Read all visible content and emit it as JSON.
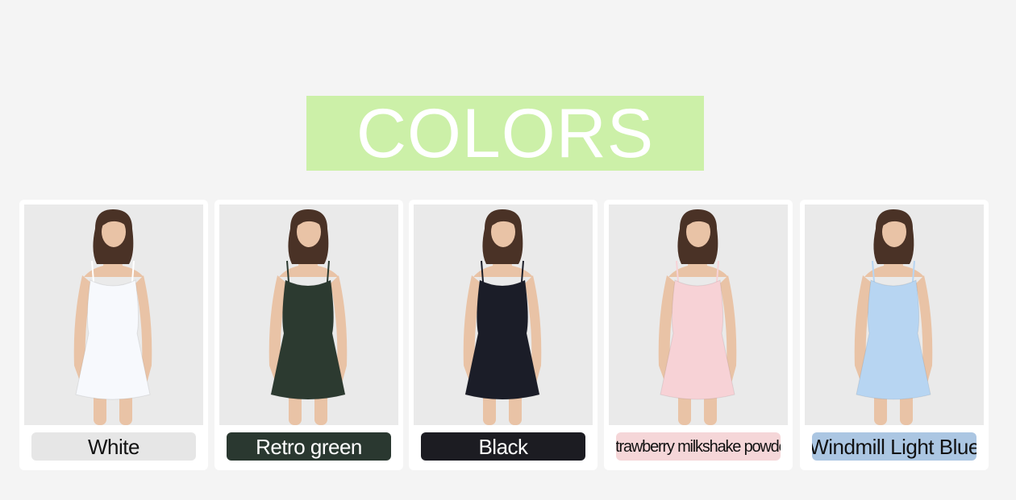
{
  "banner": {
    "title": "COLORS",
    "bg": "#ccf0a8"
  },
  "variants": [
    {
      "name": "White",
      "swatch_bg": "#e6e6e6",
      "text_color": "#111111",
      "dress_color": "#f7f9fd",
      "strap_color": "#ffffff"
    },
    {
      "name": "Retro green",
      "swatch_bg": "#2a3830",
      "text_color": "#ffffff",
      "dress_color": "#2c3a30",
      "strap_color": "#2c3a30"
    },
    {
      "name": "Black",
      "swatch_bg": "#1c1c22",
      "text_color": "#ffffff",
      "dress_color": "#1b1d28",
      "strap_color": "#1b1d28"
    },
    {
      "name": "Strawberry milkshake powder",
      "swatch_bg": "#f5d6d8",
      "text_color": "#111111",
      "dress_color": "#f7d2d6",
      "strap_color": "#f7d2d6"
    },
    {
      "name": "Windmill Light Blue",
      "swatch_bg": "#abc6e2",
      "text_color": "#111111",
      "dress_color": "#b7d5f2",
      "strap_color": "#b7d5f2"
    }
  ]
}
